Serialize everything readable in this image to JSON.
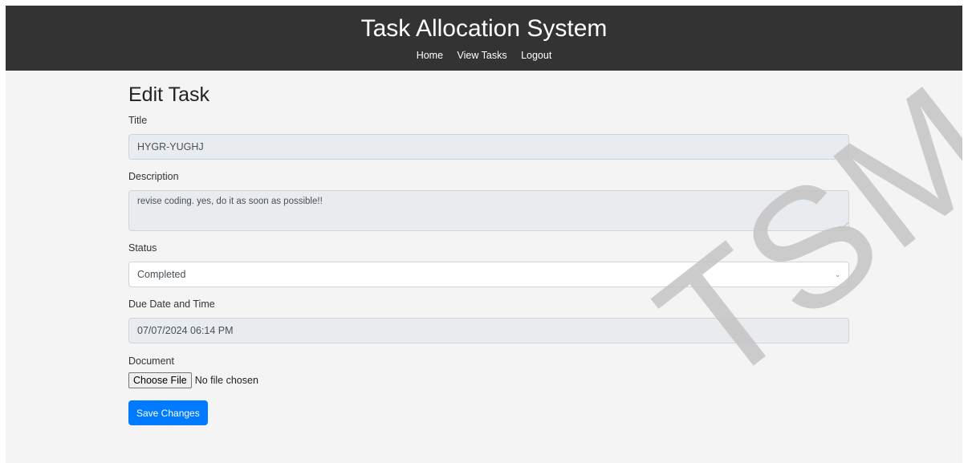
{
  "header": {
    "title": "Task Allocation System",
    "nav": [
      "Home",
      "View Tasks",
      "Logout"
    ]
  },
  "form": {
    "heading": "Edit Task",
    "title_label": "Title",
    "title_value": "HYGR-YUGHJ",
    "description_label": "Description",
    "description_value": "revise coding. yes, do it as soon as possible!!",
    "status_label": "Status",
    "status_value": "Completed",
    "due_label": "Due Date and Time",
    "due_value": "07/07/2024 06:14 PM",
    "document_label": "Document",
    "choose_file_label": "Choose File",
    "no_file_text": "No file chosen",
    "save_label": "Save Changes"
  },
  "watermark": "TSM",
  "colors": {
    "header_bg": "#333333",
    "page_bg": "#f4f4f4",
    "readonly_bg": "#e9ecef",
    "primary": "#007bff"
  }
}
